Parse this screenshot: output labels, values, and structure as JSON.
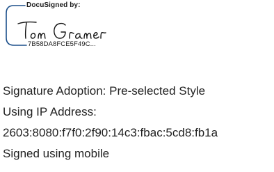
{
  "signature": {
    "header": "DocuSigned by:",
    "signer_name": "Tom Gramer",
    "envelope_id": "7B58DA8FCE5F49C...",
    "accent_color": "#1b4f8a"
  },
  "details": {
    "adoption": "Signature Adoption: Pre-selected Style",
    "ip_label": "Using IP Address:",
    "ip_address": "2603:8080:f7f0:2f90:14c3:fbac:5cd8:fb1a",
    "signed_via": "Signed using mobile"
  }
}
